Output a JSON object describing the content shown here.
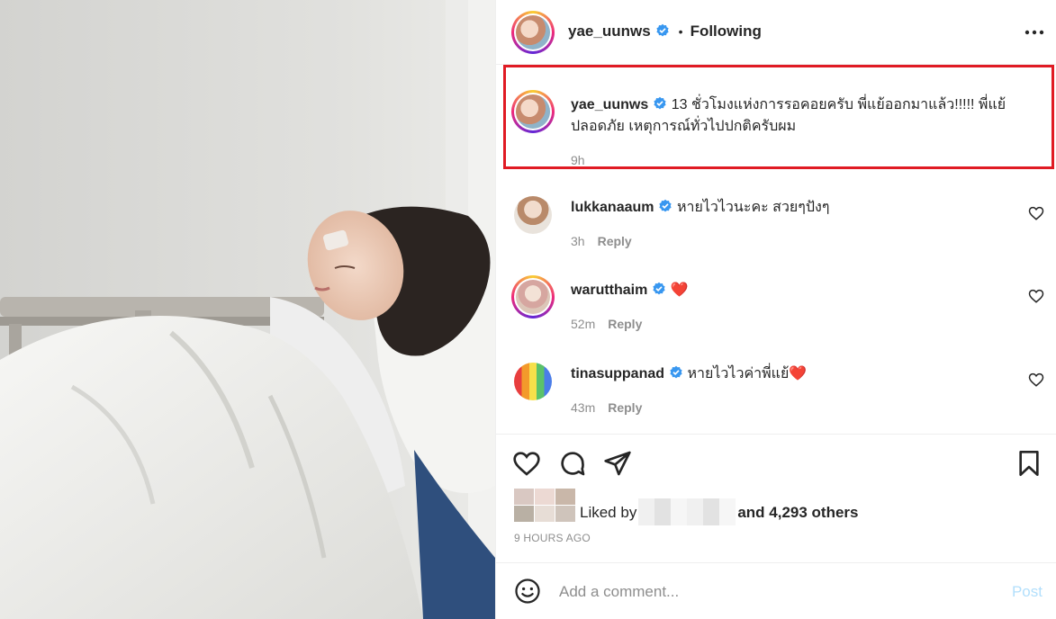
{
  "post": {
    "author": "yae_uunws",
    "follow_state": "Following",
    "separator": "•"
  },
  "caption": {
    "author": "yae_uunws",
    "text": "13 ชั่วโมงแห่งการรอคอยครับ พี่แย้ออกมาแล้ว!!!!! พี่แย้ปลอดภัย เหตุการณ์ทั่วไปปกติครับผม",
    "time": "9h"
  },
  "comments": [
    {
      "author": "lukkanaaum",
      "text": "หายไวไวนะคะ สวยๆปังๆ",
      "time": "3h",
      "reply": "Reply"
    },
    {
      "author": "warutthaim",
      "text": "❤️",
      "time": "52m",
      "reply": "Reply"
    },
    {
      "author": "tinasuppanad",
      "text": "หายไวไวค่าพี่แย้❤️",
      "time": "43m",
      "reply": "Reply"
    }
  ],
  "likes": {
    "prefix": "Liked by",
    "suffix": "and 4,293 others"
  },
  "timestamp": "9 HOURS AGO",
  "add_comment": {
    "placeholder": "Add a comment...",
    "post_label": "Post"
  },
  "colors": {
    "highlight_border": "#e01b24",
    "verified_blue": "#3897f0",
    "post_button_disabled": "#b2dffc",
    "heart_red": "#ed4956"
  },
  "icons": [
    "more-options-icon",
    "verified-badge-icon",
    "heart-icon",
    "comment-icon",
    "share-icon",
    "bookmark-icon",
    "emoji-icon"
  ]
}
